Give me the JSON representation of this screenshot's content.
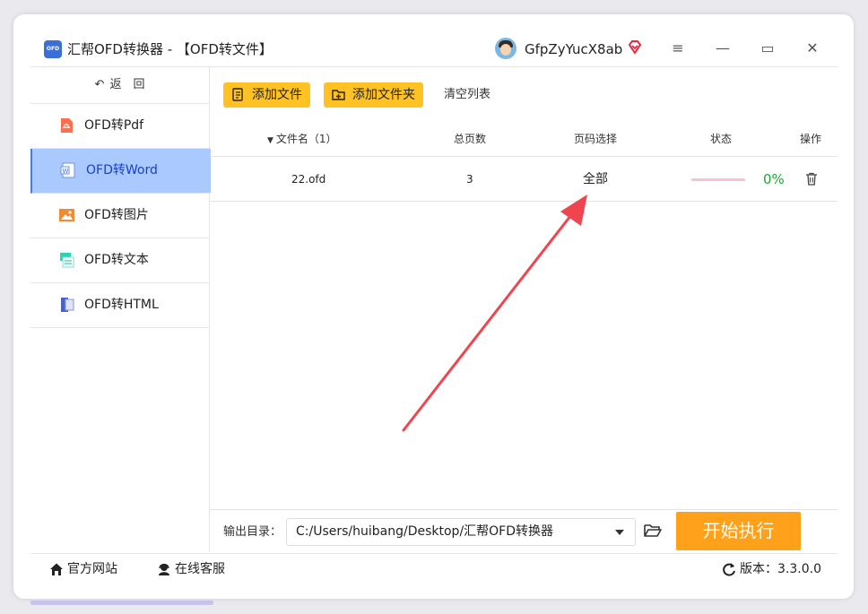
{
  "app": {
    "icon_text": "OFD",
    "title": "汇帮OFD转换器 - 【OFD转文件】",
    "username": "GfpZyYucX8ab"
  },
  "window_controls": {
    "menu": "≡",
    "minimize": "—",
    "maximize": "▭",
    "close": "✕"
  },
  "sidebar": {
    "back_label": "返　回",
    "items": [
      {
        "label": "OFD转Pdf",
        "icon": "pdf-icon",
        "active": false
      },
      {
        "label": "OFD转Word",
        "icon": "word-icon",
        "active": true
      },
      {
        "label": "OFD转图片",
        "icon": "image-icon",
        "active": false
      },
      {
        "label": "OFD转文本",
        "icon": "text-icon",
        "active": false
      },
      {
        "label": "OFD转HTML",
        "icon": "html-icon",
        "active": false
      }
    ]
  },
  "toolbar": {
    "add_file": "添加文件",
    "add_folder": "添加文件夹",
    "clear_list": "清空列表"
  },
  "table": {
    "headers": {
      "filename": "文件名（1）",
      "pages": "总页数",
      "page_select": "页码选择",
      "status": "状态",
      "action": "操作"
    },
    "rows": [
      {
        "filename": "22.ofd",
        "pages": "3",
        "page_select": "全部",
        "progress_percent": 0,
        "progress_text": "0%"
      }
    ]
  },
  "output": {
    "label": "输出目录：",
    "path": "C:/Users/huibang/Desktop/汇帮OFD转换器",
    "start_button": "开始执行"
  },
  "footer": {
    "website": "官方网站",
    "support": "在线客服",
    "version": "版本：3.3.0.0"
  },
  "colors": {
    "accent_yellow": "#ffc222",
    "start_orange": "#ffa11a",
    "active_nav": "#a9c9ff",
    "progress_green": "#1aa832",
    "annotation_red": "#f0454f"
  }
}
